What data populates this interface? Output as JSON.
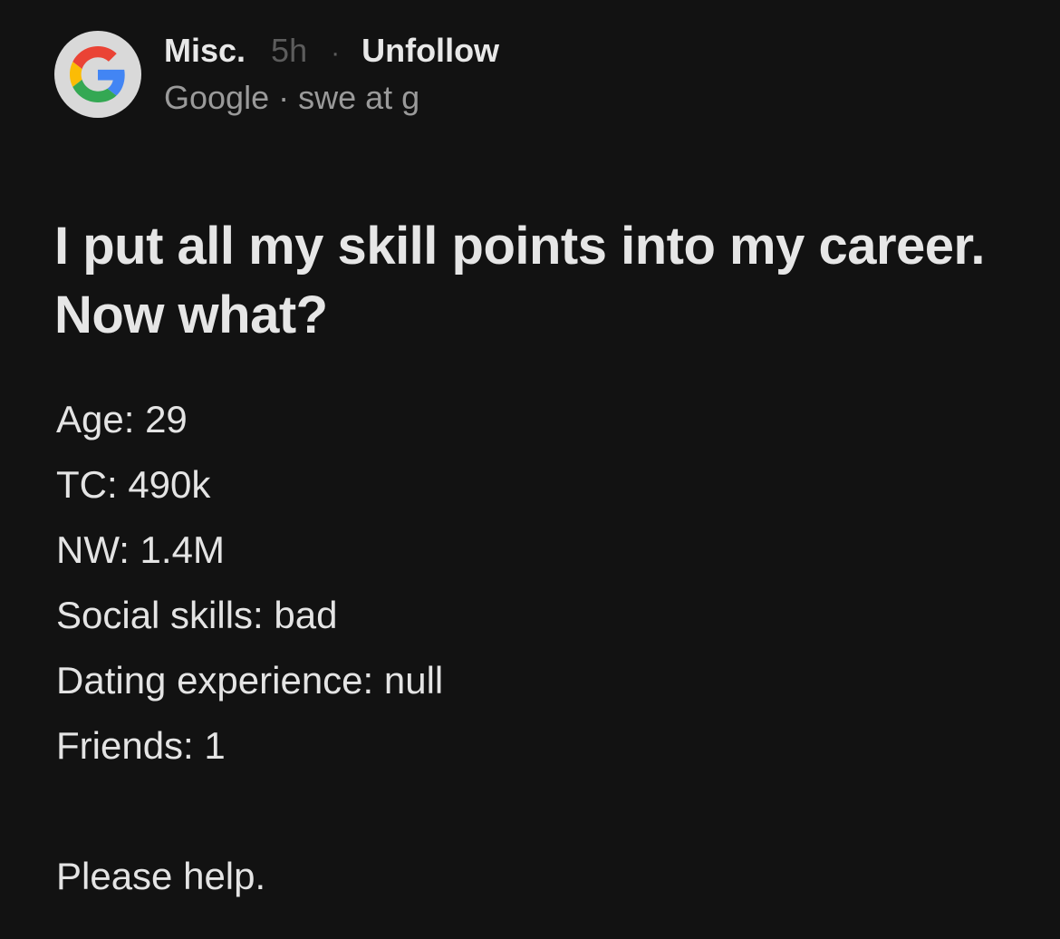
{
  "post": {
    "channel": "Misc.",
    "time": "5h",
    "separator": "·",
    "unfollow_label": "Unfollow",
    "author_line": "Google · swe at g",
    "avatar_icon": "google-g-logo-icon",
    "title": "I put all my skill points into my career. Now what?",
    "lines": [
      "Age: 29",
      "TC: 490k",
      "NW: 1.4M",
      "Social skills: bad",
      "Dating experience: null",
      "Friends: 1"
    ],
    "closing": "Please help."
  },
  "colors": {
    "background": "#121212",
    "text": "#e6e6e6",
    "muted": "#9a9a9a",
    "dim": "#5c5c5c",
    "avatar_bg": "#d9d9d9",
    "google_blue": "#4285F4",
    "google_red": "#EA4335",
    "google_yellow": "#FBBC05",
    "google_green": "#34A853"
  }
}
